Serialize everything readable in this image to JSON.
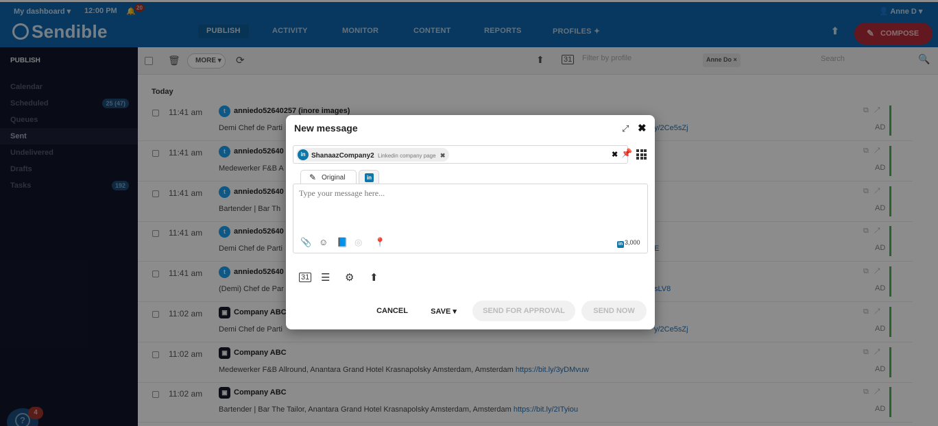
{
  "header": {
    "dashboard_label": "My dashboard",
    "time": "12:00 PM",
    "notifications_count": "20",
    "user_name": "Anne D",
    "logo": "Sendible",
    "nav": [
      "PUBLISH",
      "ACTIVITY",
      "MONITOR",
      "CONTENT",
      "REPORTS",
      "PROFILES"
    ],
    "compose_label": "COMPOSE",
    "accent_color": "#0f67ad",
    "compose_color": "#b22c38"
  },
  "sidebar": {
    "title": "PUBLISH",
    "items": [
      {
        "label": "Calendar",
        "badge": ""
      },
      {
        "label": "Scheduled",
        "badge": "25 (47)"
      },
      {
        "label": "Queues",
        "badge": ""
      },
      {
        "label": "Sent",
        "badge": ""
      },
      {
        "label": "Undelivered",
        "badge": ""
      },
      {
        "label": "Drafts",
        "badge": ""
      },
      {
        "label": "Tasks",
        "badge": "192"
      }
    ],
    "help_badge": "4"
  },
  "toolbar": {
    "more_label": "MORE",
    "filter_placeholder": "Filter by profile",
    "filter_chip": "Anne Do",
    "search_placeholder": "Search"
  },
  "feed": {
    "group_label": "Today",
    "rows": [
      {
        "time": "11:41 am",
        "network": "twitter",
        "author": "anniedo52640257 (inore images)",
        "text": "Demi Chef de Parti",
        "link": "y/2Ce5sZj",
        "owner": "AD"
      },
      {
        "time": "11:41 am",
        "network": "twitter",
        "author": "anniedo52640",
        "text": "Medewerker F&B A",
        "link": "",
        "owner": "AD"
      },
      {
        "time": "11:41 am",
        "network": "twitter",
        "author": "anniedo52640",
        "text": "Bartender | Bar Th",
        "link": "",
        "owner": "AD"
      },
      {
        "time": "11:41 am",
        "network": "twitter",
        "author": "anniedo52640",
        "text": "Demi Chef de Parti",
        "link": "E",
        "owner": "AD"
      },
      {
        "time": "11:41 am",
        "network": "twitter",
        "author": "anniedo52640",
        "text": "(Demi) Chef de Par",
        "link": "sLV8",
        "owner": "AD"
      },
      {
        "time": "11:02 am",
        "network": "company",
        "author": "Company ABC",
        "text": "Demi Chef de Parti",
        "link": "y/2Ce5sZj",
        "owner": "AD"
      },
      {
        "time": "11:02 am",
        "network": "company",
        "author": "Company ABC",
        "text": "Medewerker F&B Allround, Anantara Grand Hotel Krasnapolsky Amsterdam, Amsterdam",
        "link": "https://bit.ly/3yDMvuw",
        "owner": "AD"
      },
      {
        "time": "11:02 am",
        "network": "company",
        "author": "Company ABC",
        "text": "Bartender | Bar The Tailor, Anantara Grand Hotel Krasnapolsky Amsterdam, Amsterdam",
        "link": "https://bit.ly/2ITyiou",
        "owner": "AD"
      }
    ]
  },
  "modal": {
    "title": "New message",
    "profile": {
      "name": "ShanaazCompany2",
      "type": "Linkedin company page"
    },
    "tabs": {
      "original": "Original"
    },
    "editor_placeholder": "Type your message here...",
    "char_count": "3,000",
    "buttons": {
      "cancel": "CANCEL",
      "save": "SAVE",
      "approval": "SEND FOR APPROVAL",
      "now": "SEND NOW"
    },
    "linkedin_color": "#0e76a8"
  }
}
